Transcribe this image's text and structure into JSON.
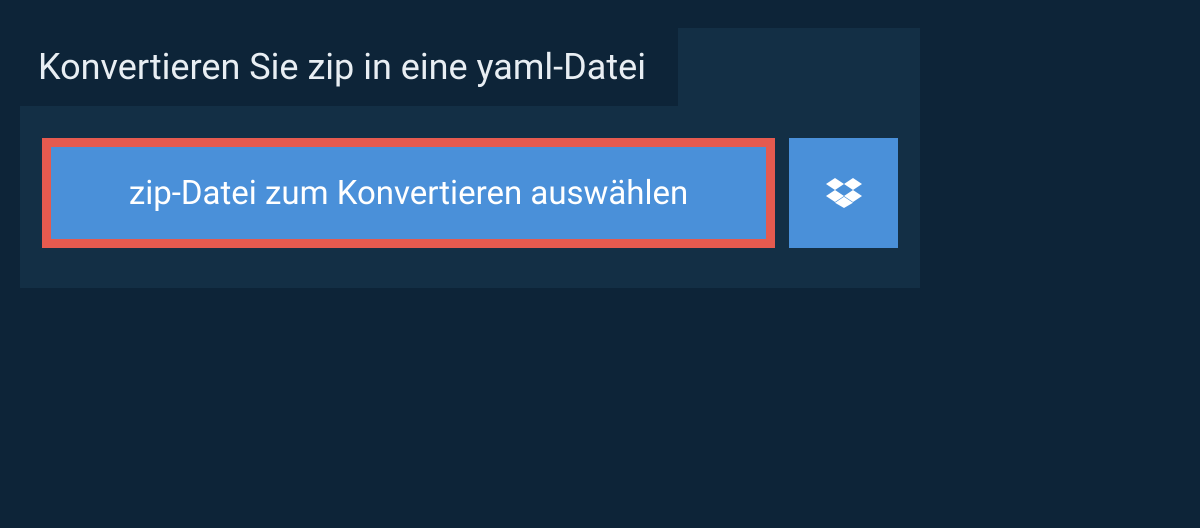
{
  "header": {
    "title": "Konvertieren Sie zip in eine yaml-Datei"
  },
  "actions": {
    "select_file_label": "zip-Datei zum Konvertieren auswählen"
  },
  "colors": {
    "page_bg": "#0d2438",
    "panel_bg": "#132f45",
    "button_bg": "#4a90d9",
    "highlight_border": "#e55a4f",
    "text_light": "#e8eef3",
    "text_white": "#ffffff"
  }
}
